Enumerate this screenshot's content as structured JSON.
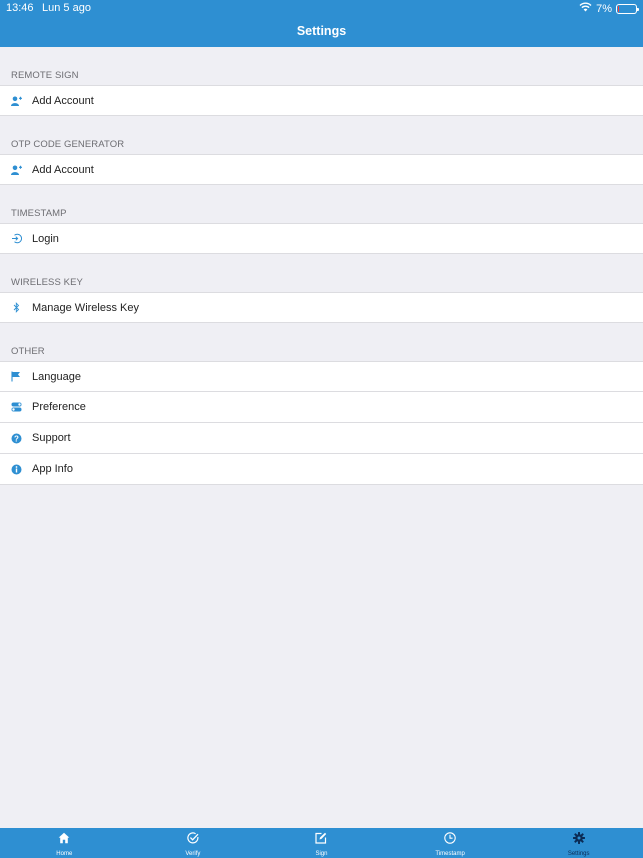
{
  "status": {
    "time": "13:46",
    "date": "Lun 5 ago",
    "battery": "7%",
    "battery_level": 0.07
  },
  "header": {
    "title": "Settings"
  },
  "sections": [
    {
      "title": "REMOTE SIGN",
      "items": [
        {
          "label": "Add Account",
          "icon": "add-user-icon"
        }
      ]
    },
    {
      "title": "OTP CODE GENERATOR",
      "items": [
        {
          "label": "Add Account",
          "icon": "add-user-icon"
        }
      ]
    },
    {
      "title": "TIMESTAMP",
      "items": [
        {
          "label": "Login",
          "icon": "login-icon"
        }
      ]
    },
    {
      "title": "WIRELESS KEY",
      "items": [
        {
          "label": "Manage Wireless Key",
          "icon": "bluetooth-icon"
        }
      ]
    },
    {
      "title": "OTHER",
      "items": [
        {
          "label": "Language",
          "icon": "flag-icon"
        },
        {
          "label": "Preference",
          "icon": "toggles-icon"
        },
        {
          "label": "Support",
          "icon": "question-icon"
        },
        {
          "label": "App Info",
          "icon": "info-icon"
        }
      ]
    }
  ],
  "tabs": [
    {
      "label": "Home",
      "icon": "home-icon"
    },
    {
      "label": "Verify",
      "icon": "check-circle-icon"
    },
    {
      "label": "Sign",
      "icon": "edit-icon"
    },
    {
      "label": "Timestamp",
      "icon": "clock-icon"
    },
    {
      "label": "Settings",
      "icon": "gear-icon",
      "active": true
    }
  ],
  "colors": {
    "primary": "#2e8fd2",
    "background": "#efeff4",
    "active_tab": "#0b2b55",
    "battery_low": "#ff3b30"
  }
}
